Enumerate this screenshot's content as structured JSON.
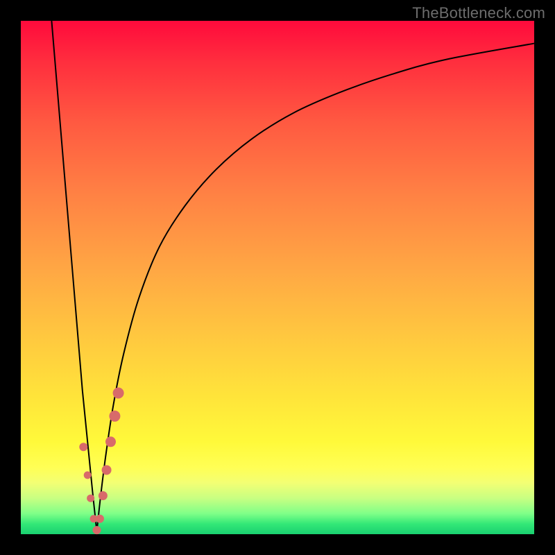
{
  "watermark": "TheBottleneck.com",
  "colors": {
    "frame_bg_top": "#ff0a3c",
    "frame_bg_bottom": "#19d070",
    "curve": "#000000",
    "marker": "#d86a6a",
    "page_bg": "#000000",
    "watermark": "#6d6d6d"
  },
  "chart_data": {
    "type": "line",
    "title": "",
    "xlabel": "",
    "ylabel": "",
    "xlim": [
      0,
      100
    ],
    "ylim": [
      0,
      100
    ],
    "series": [
      {
        "name": "left-branch",
        "x": [
          6,
          7,
          8,
          9,
          10,
          11,
          12,
          13,
          14,
          14.8
        ],
        "values": [
          100,
          88,
          76,
          64,
          52,
          40,
          28,
          18,
          8,
          0.5
        ]
      },
      {
        "name": "right-branch",
        "x": [
          14.8,
          15.5,
          16.5,
          18,
          20,
          23,
          27,
          32,
          38,
          45,
          53,
          62,
          72,
          83,
          100
        ],
        "values": [
          0.5,
          7,
          15,
          25,
          35,
          46,
          56,
          64,
          71,
          77,
          82,
          86,
          89.5,
          92.5,
          95.6
        ]
      }
    ],
    "markers": {
      "name": "highlight-points",
      "x": [
        12.2,
        13.0,
        13.6,
        14.2,
        14.8,
        15.4,
        16.0,
        16.7,
        17.5,
        18.3,
        19.0
      ],
      "values": [
        17.0,
        11.5,
        7.0,
        3.0,
        0.8,
        3.0,
        7.5,
        12.5,
        18.0,
        23.0,
        27.5
      ],
      "r": [
        6,
        5.5,
        5.5,
        5.5,
        6,
        6,
        6.5,
        7,
        7.5,
        8,
        8
      ]
    }
  }
}
